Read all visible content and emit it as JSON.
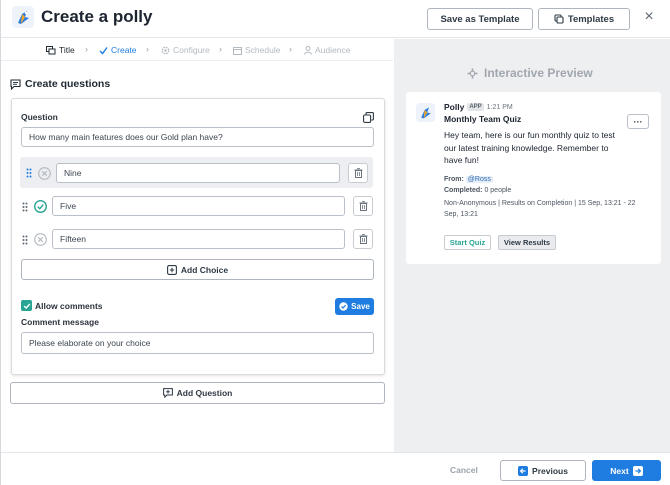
{
  "header": {
    "title": "Create a polly",
    "save_template_label": "Save as Template",
    "templates_label": "Templates",
    "close_glyph": "×"
  },
  "stepper": {
    "steps": [
      {
        "label": "Title",
        "state": "done"
      },
      {
        "label": "Create",
        "state": "active"
      },
      {
        "label": "Configure",
        "state": "upcoming"
      },
      {
        "label": "Schedule",
        "state": "upcoming"
      },
      {
        "label": "Audience",
        "state": "upcoming"
      }
    ]
  },
  "editor": {
    "section_title": "Create questions",
    "question_label": "Question",
    "question_value": "How many main features does our Gold plan have?",
    "choices": [
      {
        "value": "Nine",
        "status": "incorrect"
      },
      {
        "value": "Five",
        "status": "correct"
      },
      {
        "value": "Fifteen",
        "status": "incorrect"
      }
    ],
    "add_choice_label": "Add Choice",
    "allow_comments_label": "Allow comments",
    "allow_comments_checked": true,
    "save_label": "Save",
    "comment_message_label": "Comment message",
    "comment_message_value": "Please elaborate on your choice",
    "add_question_label": "Add Question"
  },
  "preview": {
    "title": "Interactive Preview",
    "sender": "Polly",
    "badge": "APP",
    "time": "1:21 PM",
    "message_title": "Monthly Team Quiz",
    "message_body": "Hey team, here is our fun monthly quiz to test our latest training knowledge. Remember to have fun!",
    "more_label": "···",
    "from_label": "From:",
    "from_value": "@Ross",
    "completed_label": "Completed:",
    "completed_value": "0 people",
    "details": "Non-Anonymous | Results on Completion | 15 Sep, 13:21 - 22 Sep, 13:21",
    "start_quiz_label": "Start Quiz",
    "view_results_label": "View Results"
  },
  "footer": {
    "cancel_label": "Cancel",
    "previous_label": "Previous",
    "next_label": "Next"
  },
  "colors": {
    "primary": "#1f7ce0",
    "success": "#2aa594",
    "muted": "#9aa3ad"
  }
}
